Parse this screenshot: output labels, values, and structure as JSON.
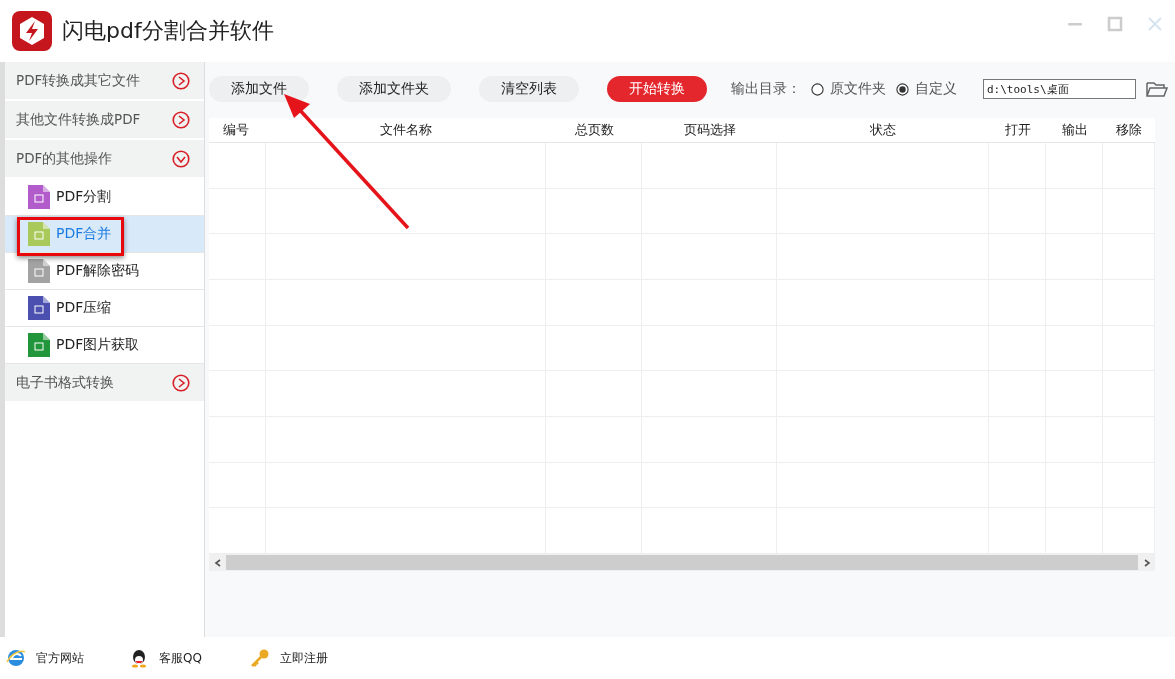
{
  "window": {
    "title": "闪电pdf分割合并软件"
  },
  "sidebar": [
    {
      "kind": "category",
      "label": "PDF转换成其它文件",
      "expanded": false
    },
    {
      "kind": "category",
      "label": "其他文件转换成PDF",
      "expanded": false
    },
    {
      "kind": "category",
      "label": "PDF的其他操作",
      "expanded": true,
      "children": [
        {
          "label": "PDF分割",
          "color": "#b25ccb",
          "selected": false
        },
        {
          "label": "PDF合并",
          "color": "#a9c95a",
          "selected": true
        },
        {
          "label": "PDF解除密码",
          "color": "#a3a3a3",
          "selected": false
        },
        {
          "label": "PDF压缩",
          "color": "#4a4fb0",
          "selected": false
        },
        {
          "label": "PDF图片获取",
          "color": "#22963a",
          "selected": false
        }
      ]
    },
    {
      "kind": "category",
      "label": "电子书格式转换",
      "expanded": false
    }
  ],
  "toolbar": {
    "buttons": [
      {
        "label": "添加文件",
        "kind": "plain"
      },
      {
        "label": "添加文件夹",
        "kind": "plain"
      },
      {
        "label": "清空列表",
        "kind": "plain"
      },
      {
        "label": "开始转换",
        "kind": "primary"
      }
    ],
    "output_label": "输出目录：",
    "output_options": [
      {
        "label": "原文件夹",
        "selected": false
      },
      {
        "label": "自定义",
        "selected": true
      }
    ],
    "output_path": "d:\\tools\\桌面"
  },
  "table": {
    "columns": [
      "编号",
      "文件名称",
      "总页数",
      "页码选择",
      "状态",
      "打开",
      "输出",
      "移除"
    ]
  },
  "footer": [
    {
      "label": "官方网站",
      "kind": "web"
    },
    {
      "label": "客服QQ",
      "kind": "qq"
    },
    {
      "label": "立即注册",
      "kind": "key"
    }
  ]
}
